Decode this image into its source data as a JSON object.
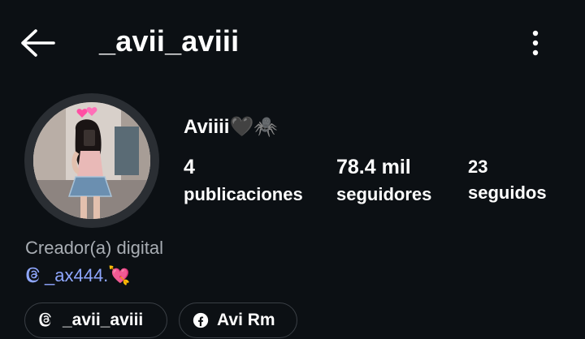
{
  "header": {
    "username": "_avii_aviii"
  },
  "profile": {
    "display_name": "Aviiii🖤🕷️",
    "category": "Creador(a) digital",
    "threads_link": "_ax444.💘"
  },
  "stats": [
    {
      "value": "4",
      "label": "publicaciones"
    },
    {
      "value": "78.4 mil",
      "label": "seguidores"
    },
    {
      "value": "23",
      "label": "seguidos"
    }
  ],
  "links": [
    {
      "icon": "threads-icon",
      "label": "_avii_aviii"
    },
    {
      "icon": "facebook-icon",
      "label": "Avi Rm"
    }
  ]
}
